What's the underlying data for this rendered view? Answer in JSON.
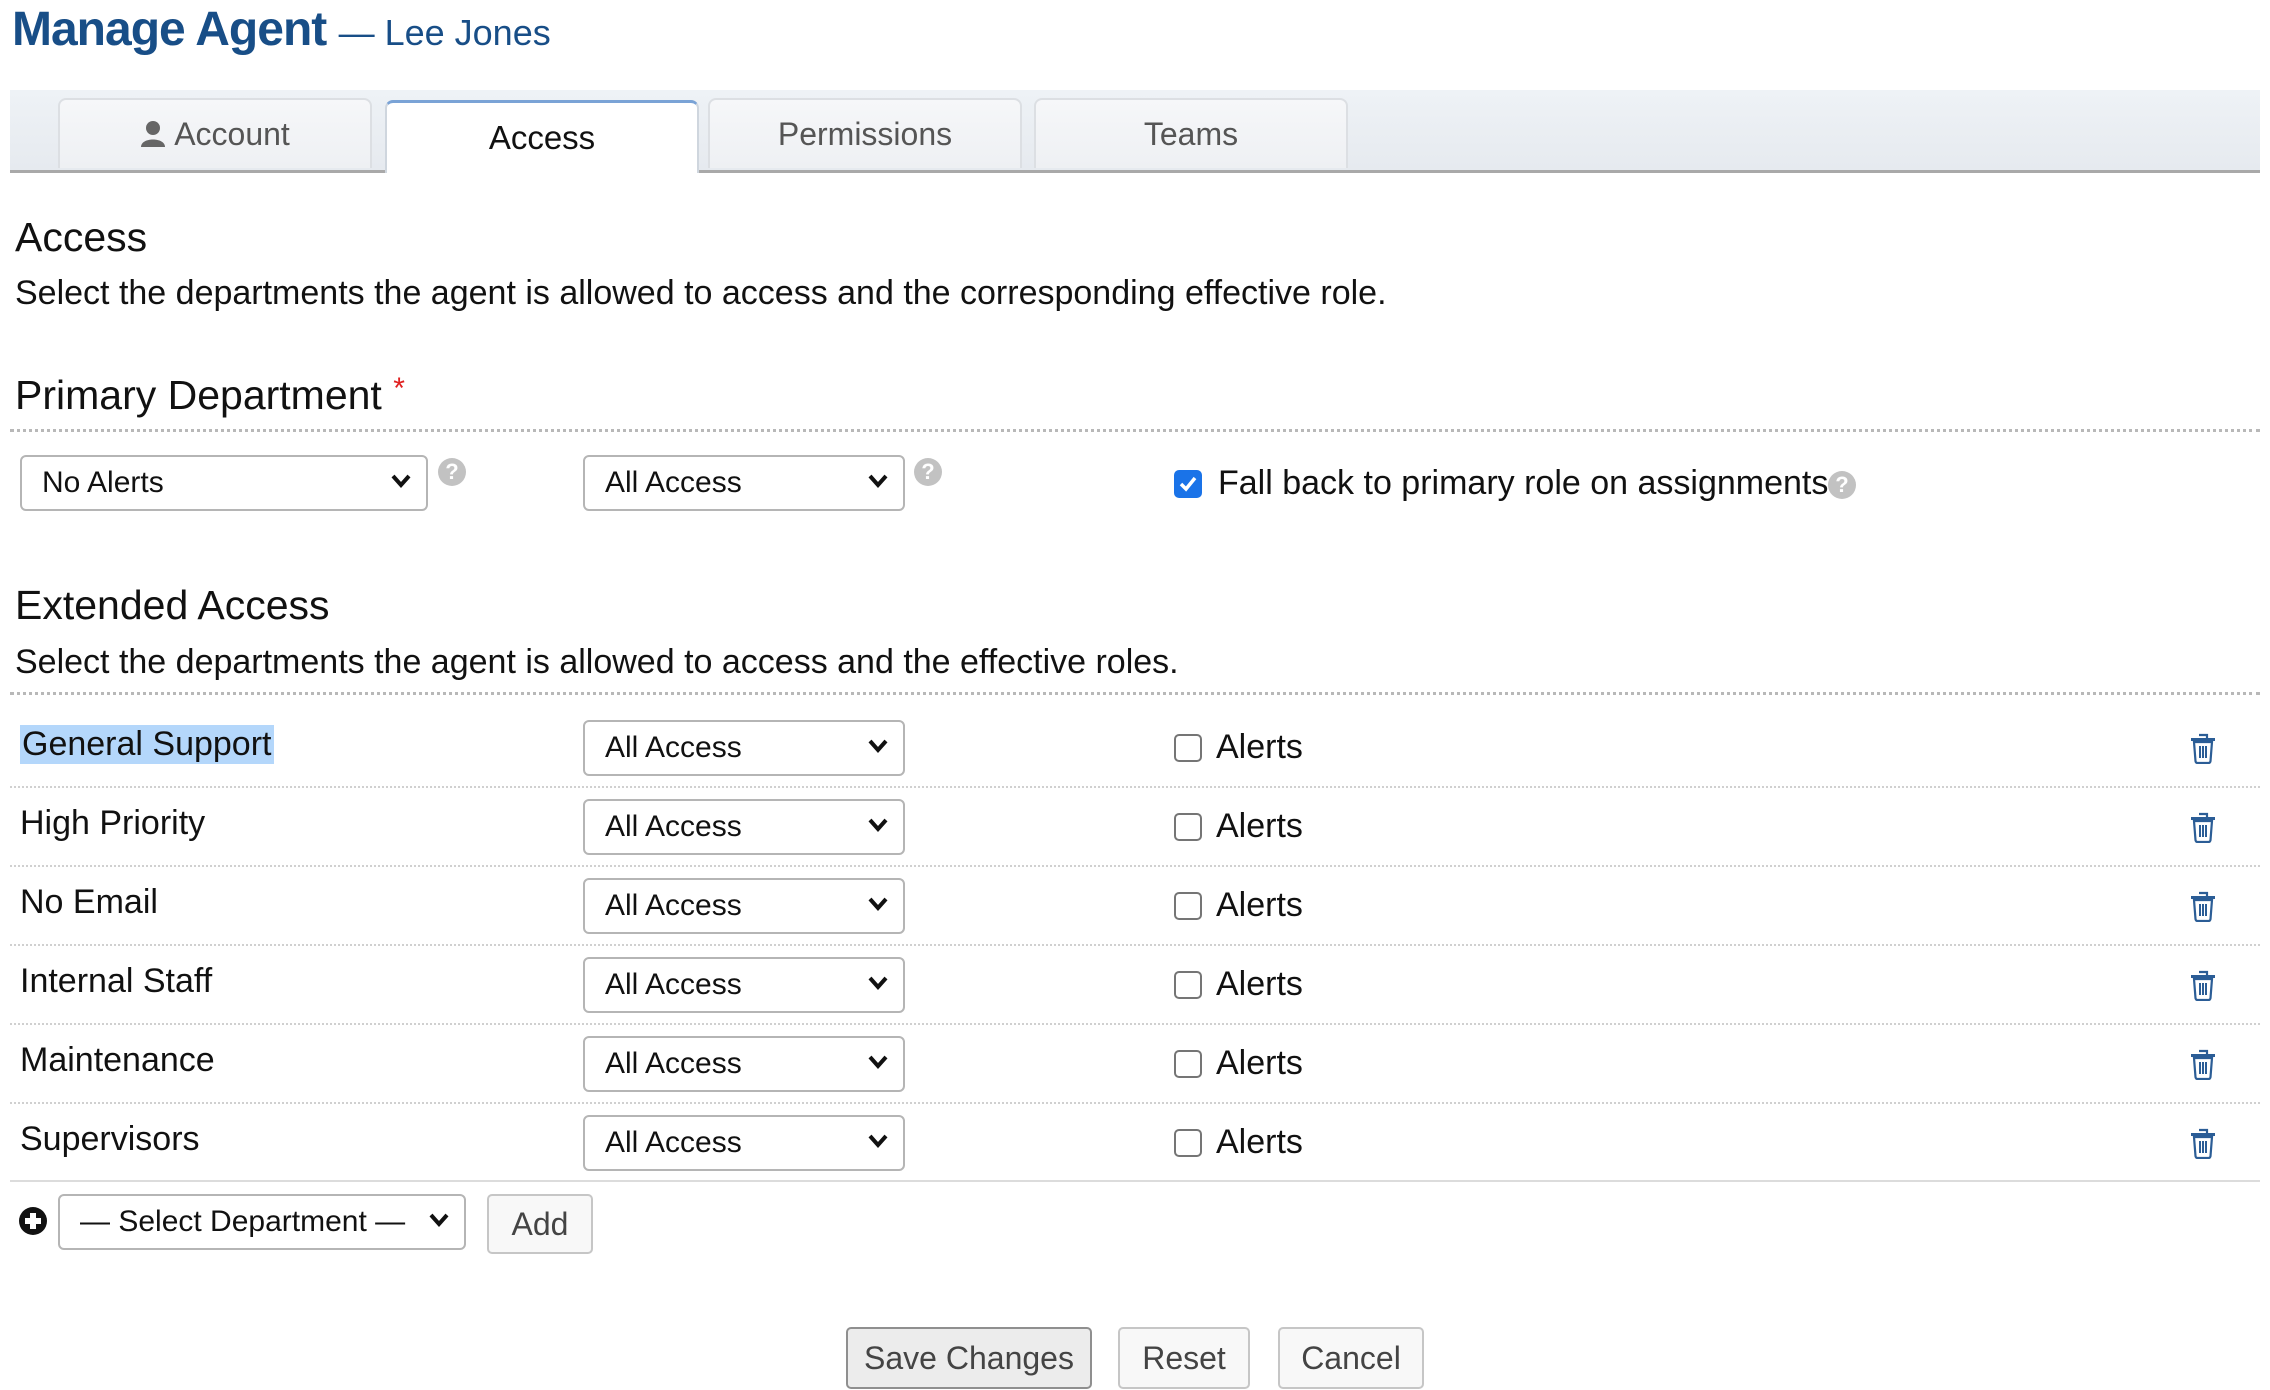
{
  "header": {
    "title": "Manage Agent",
    "subtitle": "— Lee Jones"
  },
  "tabs": [
    {
      "label": "Account",
      "icon": "user-icon",
      "active": false
    },
    {
      "label": "Access",
      "active": true
    },
    {
      "label": "Permissions",
      "active": false
    },
    {
      "label": "Teams",
      "active": false
    }
  ],
  "access": {
    "heading": "Access",
    "description": "Select the departments the agent is allowed to access and the corresponding effective role."
  },
  "primary": {
    "heading": "Primary Department",
    "required_marker": "*",
    "department_value": "No Alerts",
    "role_value": "All Access",
    "fallback_label": "Fall back to primary role on assignments",
    "fallback_checked": true,
    "help_glyph": "?"
  },
  "extended": {
    "heading": "Extended Access",
    "description": "Select the departments the agent is allowed to access and the effective roles.",
    "rows": [
      {
        "department": "General Support",
        "role": "All Access",
        "alerts_label": "Alerts",
        "alerts_checked": false,
        "selected": true
      },
      {
        "department": "High Priority",
        "role": "All Access",
        "alerts_label": "Alerts",
        "alerts_checked": false
      },
      {
        "department": "No Email",
        "role": "All Access",
        "alerts_label": "Alerts",
        "alerts_checked": false
      },
      {
        "department": "Internal Staff",
        "role": "All Access",
        "alerts_label": "Alerts",
        "alerts_checked": false
      },
      {
        "department": "Maintenance",
        "role": "All Access",
        "alerts_label": "Alerts",
        "alerts_checked": false
      },
      {
        "department": "Supervisors",
        "role": "All Access",
        "alerts_label": "Alerts",
        "alerts_checked": false
      }
    ],
    "add": {
      "select_value": "— Select Department —",
      "button_label": "Add"
    }
  },
  "actions": {
    "save": "Save Changes",
    "reset": "Reset",
    "cancel": "Cancel"
  },
  "colors": {
    "title": "#184e87",
    "checkbox_checked": "#1a73e8",
    "trash_icon": "#2b5d96",
    "required": "#e02020",
    "selection_highlight": "#b4d7fb"
  }
}
